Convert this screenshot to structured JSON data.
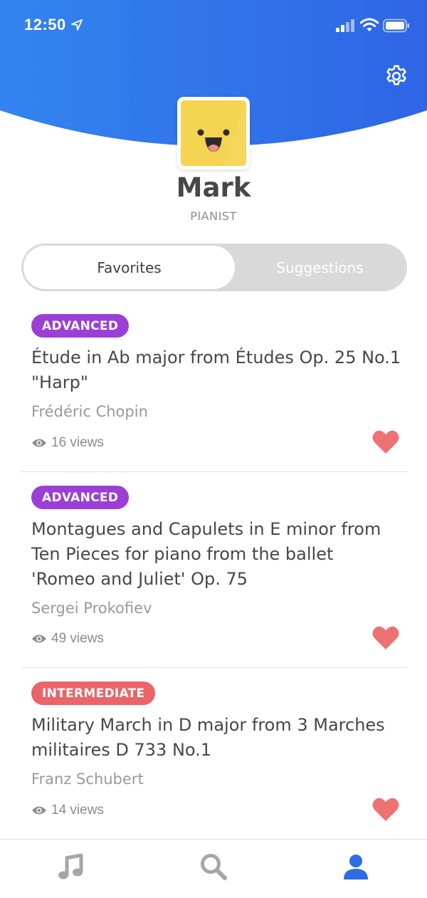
{
  "status_bar": {
    "time": "12:50"
  },
  "profile": {
    "name": "Mark",
    "role": "PIANIST"
  },
  "tabs": {
    "active": "Favorites",
    "inactive": "Suggestions"
  },
  "pieces": [
    {
      "level": "ADVANCED",
      "level_color": "#9b3fd6",
      "title": "Étude in Ab major from Études Op. 25 No.1 \"Harp\"",
      "composer": "Frédéric Chopin",
      "views": "16 views"
    },
    {
      "level": "ADVANCED",
      "level_color": "#9b3fd6",
      "title": "Montagues and Capulets in E minor from Ten Pieces for piano from the ballet 'Romeo and Juliet' Op. 75",
      "composer": "Sergei Prokofiev",
      "views": "49 views"
    },
    {
      "level": "INTERMEDIATE",
      "level_color": "#ea6468",
      "title": "Military March in D major from 3 Marches militaires D 733 No.1",
      "composer": "Franz Schubert",
      "views": "14 views"
    }
  ],
  "colors": {
    "header_start": "#2f7ff0",
    "header_end": "#2f66e8",
    "heart": "#ef7272",
    "active_tab_icon": "#2e6be6",
    "inactive_tab_icon": "#a6a6a6"
  },
  "tab_bar": [
    "music-note-icon",
    "search-icon",
    "profile-icon"
  ]
}
